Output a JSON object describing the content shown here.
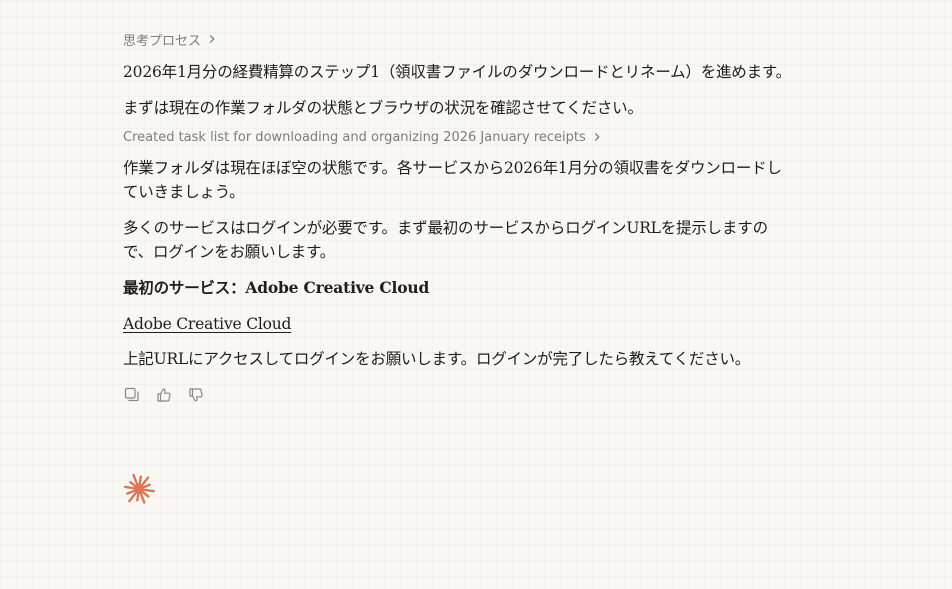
{
  "thinking": {
    "label": "思考プロセス"
  },
  "messages": {
    "p1": "2026年1月分の経費精算のステップ1（領収書ファイルのダウンロードとリネーム）を進めます。",
    "p2": "まずは現在の作業フォルダの状態とブラウザの状況を確認させてください。",
    "task_summary": "Created task list for downloading and organizing 2026 January receipts",
    "p3": "作業フォルダは現在ほぼ空の状態です。各サービスから2026年1月分の領収書をダウンロードしていきましょう。",
    "p4": "多くのサービスはログインが必要です。まず最初のサービスからログインURLを提示しますので、ログインをお願いします。",
    "p5": "最初のサービス：Adobe Creative Cloud",
    "link_text": "Adobe Creative Cloud",
    "p7": "上記URLにアクセスしてログインをお願いします。ログインが完了したら教えてください。"
  },
  "actions": {
    "copy_icon": "copy-icon",
    "thumbs_up_icon": "thumbs-up-icon",
    "thumbs_down_icon": "thumbs-down-icon"
  },
  "colors": {
    "background": "#f8f7f3",
    "text": "#1f1e1b",
    "muted": "#7f7c75",
    "accent": "#d97757"
  }
}
